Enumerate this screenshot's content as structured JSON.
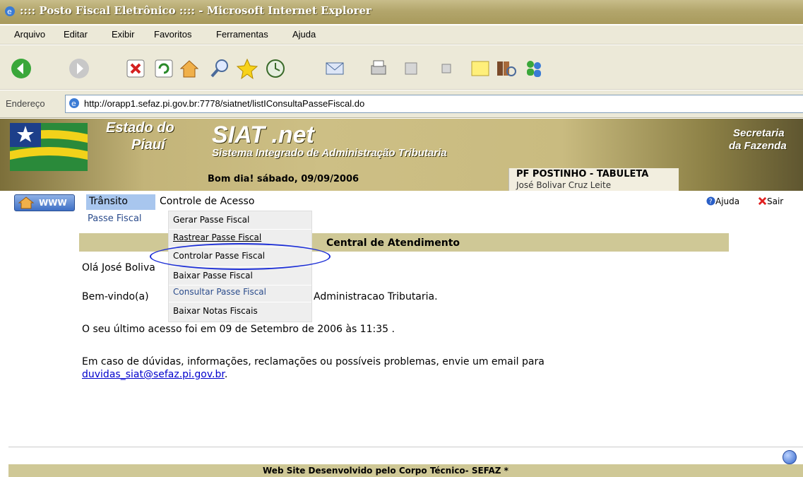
{
  "window": {
    "title": ":::: Posto Fiscal Eletrônico :::: - Microsoft Internet Explorer"
  },
  "menubar": {
    "items": [
      "Arquivo",
      "Editar",
      "Exibir",
      "Favoritos",
      "Ferramentas",
      "Ajuda"
    ]
  },
  "toolbar": {
    "icons": [
      "back-icon",
      "forward-icon",
      "stop-icon",
      "refresh-icon",
      "home-icon",
      "search-icon",
      "favorites-icon",
      "history-icon",
      "mail-icon",
      "print-icon",
      "edit-icon",
      "discuss-icon",
      "notes-icon",
      "research-icon",
      "messenger-icon"
    ]
  },
  "address": {
    "label": "Endereço",
    "url": "http://orapp1.sefaz.pi.gov.br:7778/siatnet/listIConsultaPasseFiscal.do"
  },
  "banner": {
    "estado_line1": "Estado do",
    "estado_line2": "Piauí",
    "siat_title": "SIAT .net",
    "siat_subtitle": "Sistema Integrado de Administração Tributaria",
    "secretaria_line1": "Secretaria",
    "secretaria_line2": "da Fazenda",
    "greeting": "Bom dia! sábado, 09/09/2006",
    "posto": "PF POSTINHO - TABULETA",
    "user": "José Bolivar Cruz Leite"
  },
  "nav": {
    "www": "WWW",
    "transito": "Trânsito",
    "controle_acesso": "Controle de Acesso",
    "ajuda": "Ajuda",
    "sair": "Sair",
    "submenu": "Passe Fiscal"
  },
  "dropdown": {
    "items": [
      "Gerar Passe Fiscal",
      "Rastrear Passe Fiscal",
      "Controlar Passe Fiscal",
      "Baixar Passe Fiscal",
      "Consultar Passe Fiscal",
      "Baixar Notas Fiscais"
    ]
  },
  "content": {
    "header": "Central de Atendimento",
    "hello": "Olá José Boliva",
    "welcome_prefix": "Bem-vindo(a) ",
    "welcome_suffix": "Administracao Tributaria.",
    "last_access": "O seu último acesso foi em 09 de Setembro de 2006 às 11:35 .",
    "doubts": "Em caso de dúvidas, informações, reclamações ou possíveis problemas, envie um email para",
    "email": "duvidas_siat@sefaz.pi.gov.br",
    "email_suffix": "."
  },
  "footer": {
    "text": "Web Site Desenvolvido pelo Corpo Técnico- SEFAZ *"
  },
  "colors": {
    "khaki": "#cfc896",
    "link": "#0000cc",
    "menu_highlight": "#a8c6ee",
    "ellipse": "#1d2fd6"
  }
}
